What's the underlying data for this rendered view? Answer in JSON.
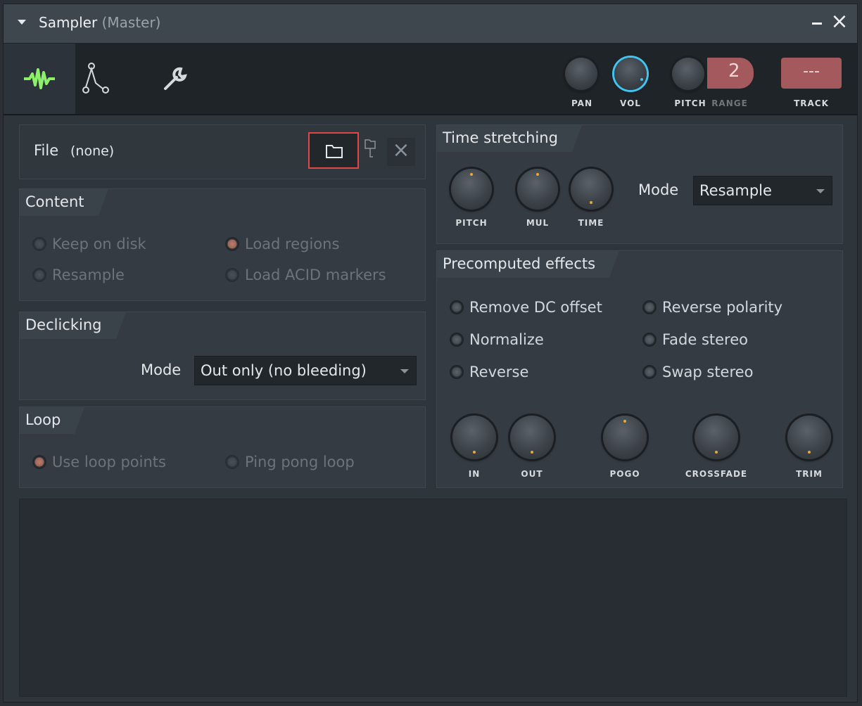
{
  "window": {
    "title": "Sampler",
    "subtitle": "(Master)"
  },
  "toolbar": {
    "tabs": [
      {
        "name": "sample-settings",
        "icon": "waveform-icon"
      },
      {
        "name": "envelope",
        "icon": "envelope-icon"
      },
      {
        "name": "misc",
        "icon": "wrench-icon"
      }
    ],
    "knobs": {
      "pan": "PAN",
      "vol": "VOL",
      "pitch": "PITCH",
      "range": "RANGE",
      "track": "TRACK"
    },
    "range_value": "2",
    "track_value": "---"
  },
  "file": {
    "label": "File",
    "value": "(none)"
  },
  "content": {
    "title": "Content",
    "options": [
      {
        "label": "Keep on disk",
        "checked": false
      },
      {
        "label": "Load regions",
        "checked": true
      },
      {
        "label": "Resample",
        "checked": false
      },
      {
        "label": "Load ACID markers",
        "checked": false
      }
    ]
  },
  "declicking": {
    "title": "Declicking",
    "mode_label": "Mode",
    "mode_value": "Out only (no bleeding)"
  },
  "loop": {
    "title": "Loop",
    "options": [
      {
        "label": "Use loop points",
        "checked": true
      },
      {
        "label": "Ping pong loop",
        "checked": false
      }
    ]
  },
  "time_stretching": {
    "title": "Time stretching",
    "knobs": [
      "PITCH",
      "MUL",
      "TIME"
    ],
    "mode_label": "Mode",
    "mode_value": "Resample"
  },
  "precomputed": {
    "title": "Precomputed effects",
    "options": [
      {
        "label": "Remove DC offset"
      },
      {
        "label": "Reverse polarity"
      },
      {
        "label": "Normalize"
      },
      {
        "label": "Fade stereo"
      },
      {
        "label": "Reverse"
      },
      {
        "label": "Swap stereo"
      }
    ],
    "knobs": [
      "IN",
      "OUT",
      "POGO",
      "CROSSFADE",
      "TRIM"
    ]
  },
  "colors": {
    "accent": "#41c5f0",
    "waveform": "#8cf06a",
    "highlight": "#e04848",
    "track": "#a45a5c"
  }
}
